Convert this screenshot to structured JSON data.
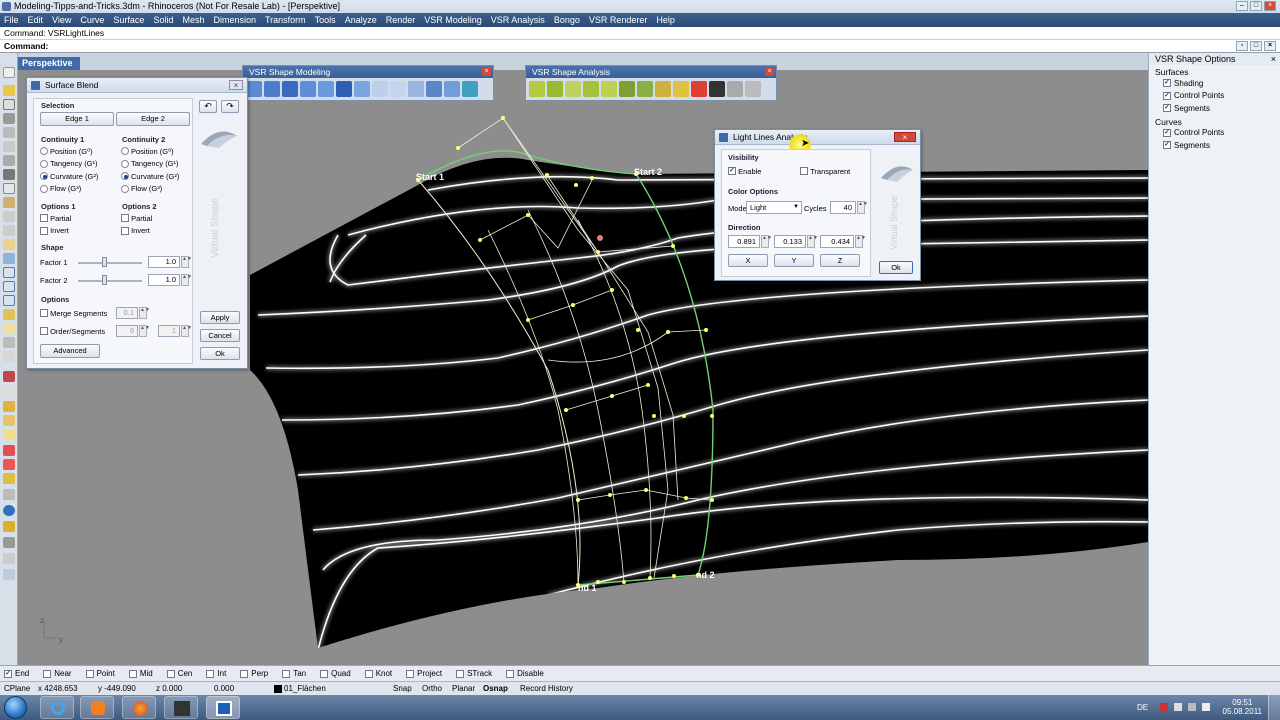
{
  "window": {
    "title": "Modeling-Tipps-and-Tricks.3dm - Rhinoceros (Not For Resale Lab) - [Perspektive]"
  },
  "menu": [
    "File",
    "Edit",
    "View",
    "Curve",
    "Surface",
    "Solid",
    "Mesh",
    "Dimension",
    "Transform",
    "Tools",
    "Analyze",
    "Render",
    "VSR Modeling",
    "VSR Analysis",
    "Bongo",
    "VSR Renderer",
    "Help"
  ],
  "command": {
    "history": "Command: VSRLightLines",
    "prompt": "Command:"
  },
  "viewport": {
    "label": "Perspektive",
    "annotations": {
      "start1": "Start 1",
      "start2": "Start 2",
      "end1": "nd 1",
      "end2": "nd 2"
    },
    "axis": {
      "z": "z",
      "y": "y"
    }
  },
  "toolbars": {
    "modeling": "VSR Shape Modeling",
    "analysis": "VSR Shape Analysis"
  },
  "surface_blend": {
    "title": "Surface Blend",
    "selection_label": "Selection",
    "edge1": "Edge 1",
    "edge2": "Edge 2",
    "continuity1": {
      "label": "Continuity 1",
      "options": [
        "Position (G⁰)",
        "Tangency (G¹)",
        "Curvature (G²)",
        "Flow (G³)"
      ],
      "selected": 2
    },
    "continuity2": {
      "label": "Continuity 2",
      "options": [
        "Position (G⁰)",
        "Tangency (G¹)",
        "Curvature (G²)",
        "Flow (G³)"
      ],
      "selected": 2
    },
    "options1": {
      "label": "Options 1",
      "items": [
        "Partial",
        "Invert"
      ]
    },
    "options2": {
      "label": "Options 2",
      "items": [
        "Partial",
        "Invert"
      ]
    },
    "shape_label": "Shape",
    "factor1": {
      "label": "Factor 1",
      "value": "1.0"
    },
    "factor2": {
      "label": "Factor 2",
      "value": "1.0"
    },
    "options_label": "Options",
    "merge": {
      "label": "Merge Segments",
      "value": "0.1"
    },
    "order": {
      "label": "Order/Segments",
      "value1": "6",
      "value2": "1"
    },
    "advanced": "Advanced",
    "apply": "Apply",
    "cancel": "Cancel",
    "ok": "Ok",
    "watermark": "Virtual Shape"
  },
  "light_lines": {
    "title": "Light Lines Analysis",
    "visibility_label": "Visibility",
    "enable": "Enable",
    "transparent": "Transparent",
    "color_options_label": "Color Options",
    "mode_label": "Mode",
    "mode_value": "Light",
    "cycles_label": "Cycles",
    "cycles_value": "40",
    "direction_label": "Direction",
    "dir_x": "0.891",
    "dir_y": "0.133",
    "dir_z": "0.434",
    "btn_x": "X",
    "btn_y": "Y",
    "btn_z": "Z",
    "ok": "Ok",
    "watermark": "Virtual Shape"
  },
  "right_panel": {
    "title": "VSR Shape Options",
    "surfaces_label": "Surfaces",
    "surfaces": [
      "Shading",
      "Control Points",
      "Segments"
    ],
    "curves_label": "Curves",
    "curves": [
      "Control Points",
      "Segments"
    ]
  },
  "osnap": [
    "End",
    "Near",
    "Point",
    "Mid",
    "Cen",
    "Int",
    "Perp",
    "Tan",
    "Quad",
    "Knot",
    "Project",
    "STrack",
    "Disable"
  ],
  "osnap_checked": [
    "End"
  ],
  "status": {
    "cplane": "CPlane",
    "x": "x 4248.653",
    "y": "y -449.090",
    "z": "z 0.000",
    "w": "0.000",
    "layer": "01_Flächen",
    "modes": [
      "Snap",
      "Ortho",
      "Planar",
      "Osnap",
      "Record History"
    ]
  },
  "taskbar": {
    "lang": "DE",
    "time": "09:51",
    "date": "05.08.2011"
  }
}
